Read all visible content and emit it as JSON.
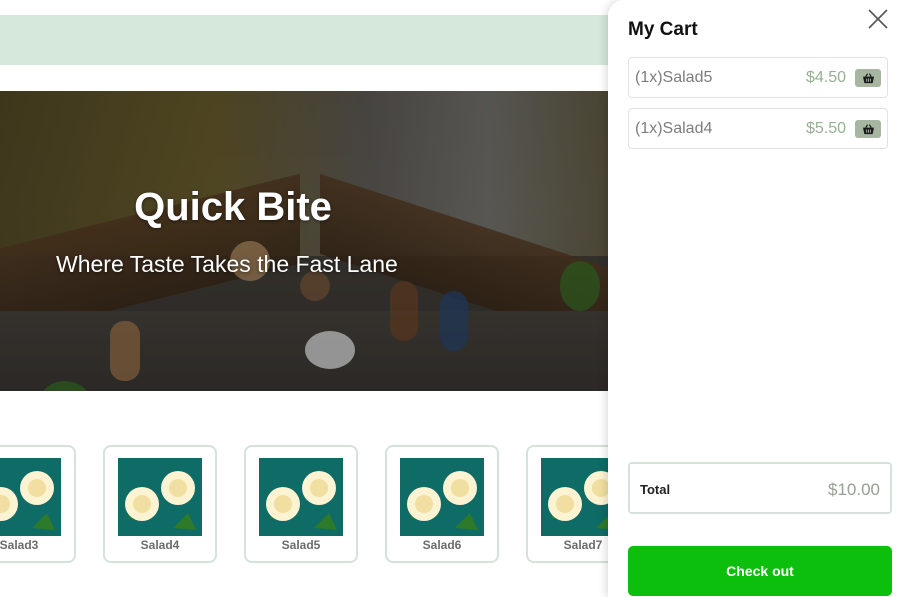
{
  "hero": {
    "title": "Quick Bite",
    "subtitle": "Where Taste Takes the Fast Lane"
  },
  "products": [
    {
      "name": "Salad3",
      "icon": "white-roses-image"
    },
    {
      "name": "Salad4",
      "icon": "white-roses-image"
    },
    {
      "name": "Salad5",
      "icon": "white-roses-image"
    },
    {
      "name": "Salad6",
      "icon": "white-roses-image"
    },
    {
      "name": "Salad7",
      "icon": "white-roses-image"
    }
  ],
  "cart": {
    "title": "My Cart",
    "close_icon": "close-icon",
    "items": [
      {
        "label": "(1x)Salad5",
        "price": "$4.50",
        "icon": "basket-icon"
      },
      {
        "label": "(1x)Salad4",
        "price": "$5.50",
        "icon": "basket-icon"
      }
    ],
    "total_label": "Total",
    "total_value": "$10.00",
    "checkout_label": "Check out"
  },
  "colors": {
    "banner": "#d6e8dc",
    "accent_green": "#0dbf0d",
    "price_green": "#95b090",
    "card_border": "#d4e3da"
  }
}
